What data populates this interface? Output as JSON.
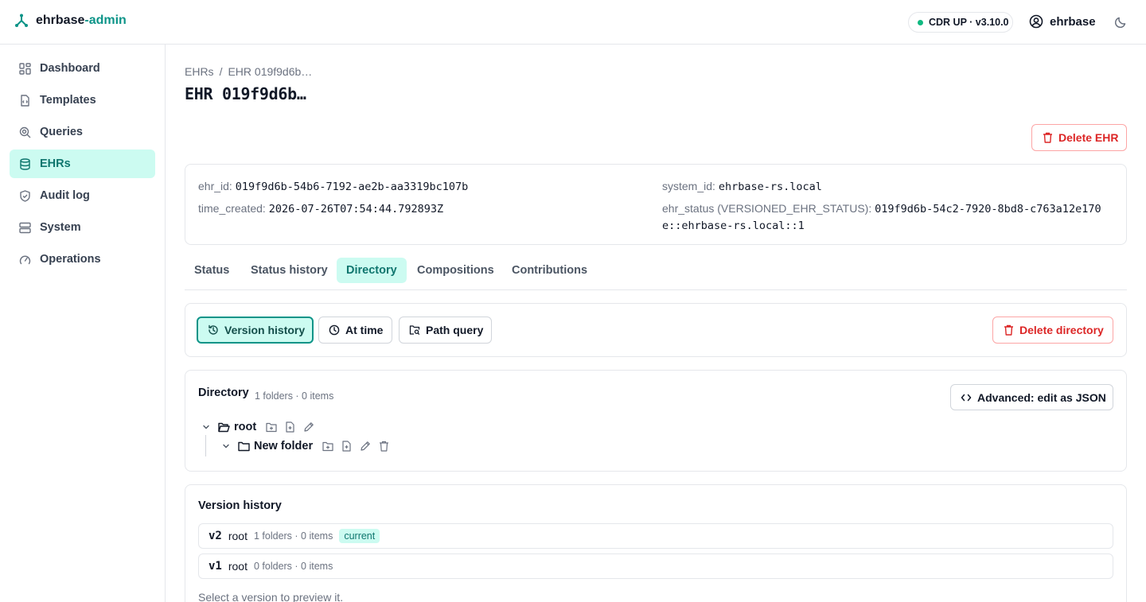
{
  "app": {
    "brand_primary": "ehrbase",
    "brand_accent": "-admin",
    "accent_color": "#0d9488"
  },
  "header": {
    "cdr_status": "CDR UP · v3.10.0",
    "username": "ehrbase",
    "theme_icon": "moon-icon"
  },
  "sidebar": {
    "items": [
      {
        "label": "Dashboard",
        "icon": "dashboard-icon"
      },
      {
        "label": "Templates",
        "icon": "file-code-icon"
      },
      {
        "label": "Queries",
        "icon": "search-icon"
      },
      {
        "label": "EHRs",
        "icon": "database-icon",
        "active": true
      },
      {
        "label": "Audit log",
        "icon": "shield-check-icon"
      },
      {
        "label": "System",
        "icon": "server-icon"
      },
      {
        "label": "Operations",
        "icon": "gauge-icon"
      }
    ]
  },
  "breadcrumb": {
    "root": "EHRs",
    "sep": "/",
    "current": "EHR 019f9d6b…"
  },
  "page": {
    "title": "EHR 019f9d6b…",
    "delete_label": "Delete EHR"
  },
  "ehr_info": {
    "ehr_id_label": "ehr_id:",
    "ehr_id": "019f9d6b-54b6-7192-ae2b-aa3319bc107b",
    "time_created_label": "time_created:",
    "time_created": "2026-07-26T07:54:44.792893Z",
    "system_id_label": "system_id:",
    "system_id": "ehrbase-rs.local",
    "ehr_status_label": "ehr_status (VERSIONED_EHR_STATUS):",
    "ehr_status_line1": "019f9d6b-54c2-7920-8bd8-c763a12e170",
    "ehr_status_line2": "e::ehrbase-rs.local::1"
  },
  "tabs": [
    {
      "label": "Status"
    },
    {
      "label": "Status history"
    },
    {
      "label": "Directory",
      "active": true
    },
    {
      "label": "Compositions"
    },
    {
      "label": "Contributions"
    }
  ],
  "toolbar": {
    "version_history": "Version history",
    "at_time": "At time",
    "path_query": "Path query",
    "delete_directory": "Delete directory"
  },
  "directory": {
    "title": "Directory",
    "summary": "1 folders · 0 items",
    "advanced_label": "Advanced: edit as JSON",
    "root_label": "root",
    "child_label": "New folder"
  },
  "version_history": {
    "title": "Version history",
    "versions": [
      {
        "version": "v2",
        "name": "root",
        "summary": "1 folders · 0 items",
        "badge": "current"
      },
      {
        "version": "v1",
        "name": "root",
        "summary": "0 folders · 0 items",
        "badge": ""
      }
    ],
    "hint": "Select a version to preview it."
  }
}
